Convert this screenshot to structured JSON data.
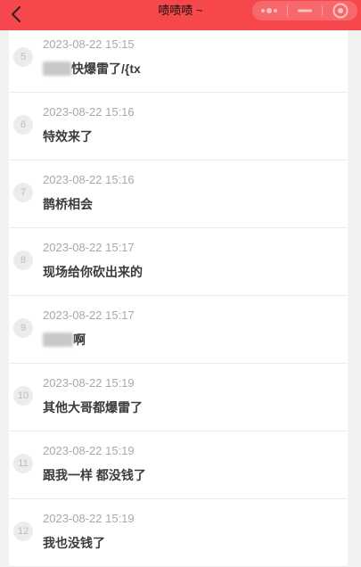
{
  "header": {
    "title": "啧啧啧 ~"
  },
  "messages": [
    {
      "index": "5",
      "time": "2023-08-22 15:15",
      "text": "快爆雷了/{tx",
      "redacted_prefix": true
    },
    {
      "index": "6",
      "time": "2023-08-22 15:16",
      "text": "特效来了"
    },
    {
      "index": "7",
      "time": "2023-08-22 15:16",
      "text": "鹊桥相会"
    },
    {
      "index": "8",
      "time": "2023-08-22 15:17",
      "text": "现场给你砍出来的"
    },
    {
      "index": "9",
      "time": "2023-08-22 15:17",
      "text": "啊",
      "redacted_prefix": true
    },
    {
      "index": "10",
      "time": "2023-08-22 15:19",
      "text": "其他大哥都爆雷了"
    },
    {
      "index": "11",
      "time": "2023-08-22 15:19",
      "text": "跟我一样 都没钱了"
    },
    {
      "index": "12",
      "time": "2023-08-22 15:19",
      "text": "我也没钱了"
    }
  ],
  "colors": {
    "header_bg": "#f5474c",
    "page_bg": "#f2f2f2"
  }
}
